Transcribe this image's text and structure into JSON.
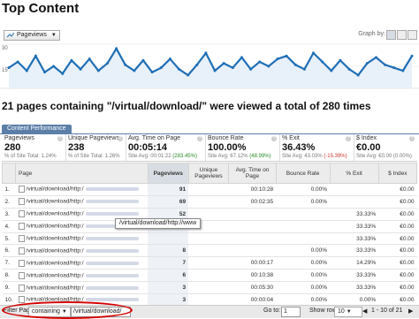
{
  "page": {
    "title": "Top Content"
  },
  "controls": {
    "metric_dropdown": "Pageviews",
    "graph_by_label": "Graph by:"
  },
  "chart_data": {
    "type": "line",
    "ylim": [
      0,
      30
    ],
    "yticks": [
      "30",
      "15"
    ],
    "series": [
      {
        "values": [
          14,
          18,
          12,
          22,
          11,
          15,
          10,
          19,
          13,
          20,
          12,
          17,
          27,
          16,
          12,
          19,
          11,
          14,
          20,
          13,
          9,
          16,
          24,
          12,
          17,
          14,
          21,
          13,
          18,
          15,
          20,
          22,
          16,
          13,
          24,
          18,
          12,
          19,
          13,
          9,
          17,
          21,
          16,
          14,
          12,
          22
        ]
      }
    ]
  },
  "headline": "21 pages containing \"/virtual/download/\" were viewed a total of 280 times",
  "tab": "Content Performance",
  "metrics": [
    {
      "name": "Pageviews",
      "value": "280",
      "sub_prefix": "% of Site Total: ",
      "sub_value": "1.24%",
      "sub_class": ""
    },
    {
      "name": "Unique Pageviews",
      "value": "238",
      "sub_prefix": "% of Site Total: ",
      "sub_value": "1.26%",
      "sub_class": ""
    },
    {
      "name": "Avg. Time on Page",
      "value": "00:05:14",
      "sub_prefix": "Site Avg: 00:01:22 ",
      "sub_value": "(283.45%)",
      "sub_class": "pos"
    },
    {
      "name": "Bounce Rate",
      "value": "100.00%",
      "sub_prefix": "Site Avg: 67.12% ",
      "sub_value": "(48.99%)",
      "sub_class": "pos"
    },
    {
      "name": "% Exit",
      "value": "36.43%",
      "sub_prefix": "Site Avg: 43.03% ",
      "sub_value": "(-15.39%)",
      "sub_class": "neg"
    },
    {
      "name": "$ Index",
      "value": "€0.00",
      "sub_prefix": "Site Avg: €0.00 ",
      "sub_value": "(0.00%)",
      "sub_class": ""
    }
  ],
  "table": {
    "columns": [
      "Page",
      "Pageviews",
      "Unique Pageviews",
      "Avg. Time on Page",
      "Bounce Rate",
      "% Exit",
      "$ Index"
    ],
    "rows": [
      {
        "n": "1.",
        "page": "/virtual/download/http:/",
        "pv": "91",
        "upv": "",
        "time": "00:10:28",
        "bounce": "0.00%",
        "exit": "",
        "idx": "€0.00"
      },
      {
        "n": "2.",
        "page": "/virtual/download/http:/",
        "pv": "69",
        "upv": "",
        "time": "00:02:35",
        "bounce": "0.00%",
        "exit": "",
        "idx": "€0.00"
      },
      {
        "n": "3.",
        "page": "/virtual/download/http:/",
        "pv": "52",
        "upv": "",
        "time": "",
        "bounce": "",
        "exit": "33.33%",
        "idx": "€0.00"
      },
      {
        "n": "4.",
        "page": "/virtual/download/http:/",
        "pv": "31",
        "upv": "",
        "time": "",
        "bounce": "",
        "exit": "33.33%",
        "idx": "€0.00"
      },
      {
        "n": "5.",
        "page": "/virtual/download/http:/",
        "pv": "",
        "upv": "",
        "time": "",
        "bounce": "",
        "exit": "33.33%",
        "idx": "€0.00"
      },
      {
        "n": "6.",
        "page": "/virtual/download/http:/",
        "pv": "8",
        "upv": "",
        "time": "",
        "bounce": "0.00%",
        "exit": "33.33%",
        "idx": "€0.00"
      },
      {
        "n": "7.",
        "page": "/virtual/download/http:/",
        "pv": "7",
        "upv": "",
        "time": "00:00:17",
        "bounce": "0.00%",
        "exit": "14.29%",
        "idx": "€0.00"
      },
      {
        "n": "8.",
        "page": "/virtual/download/http:/",
        "pv": "6",
        "upv": "",
        "time": "00:10:38",
        "bounce": "0.00%",
        "exit": "33.33%",
        "idx": "€0.00"
      },
      {
        "n": "9.",
        "page": "/virtual/download/http:/",
        "pv": "3",
        "upv": "",
        "time": "00:05:30",
        "bounce": "0.00%",
        "exit": "33.33%",
        "idx": "€0.00"
      },
      {
        "n": "10.",
        "page": "/virtual/download/http:/",
        "pv": "3",
        "upv": "",
        "time": "00:00:04",
        "bounce": "0.00%",
        "exit": "0.00%",
        "idx": "€0.00"
      }
    ]
  },
  "tooltip": "/virtual/download/http://www",
  "bottom": {
    "filter_label": "Filter Page:",
    "filter_mode": "containing",
    "filter_value": "/virtual/download/",
    "go": "Go",
    "goto_label": "Go to:",
    "goto_value": "1",
    "show_rows_label": "Show rows:",
    "show_rows_value": "10",
    "range": "1 - 10 of 21"
  }
}
